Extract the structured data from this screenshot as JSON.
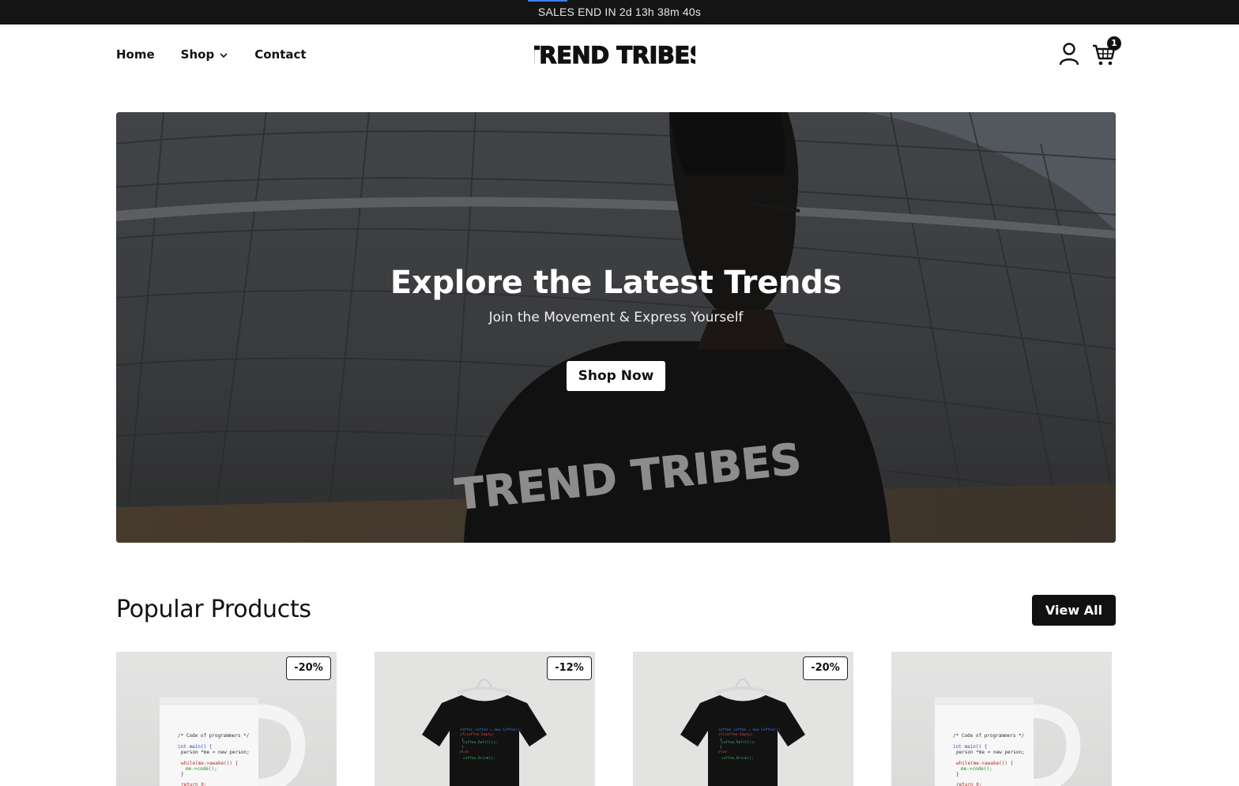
{
  "announcement": {
    "text": "SALES END IN 2d 13h 38m 40s"
  },
  "header": {
    "nav": [
      {
        "label": "Home"
      },
      {
        "label": "Shop"
      },
      {
        "label": "Contact"
      }
    ],
    "logo_text": "TREND TRIBES",
    "cart_count": "1"
  },
  "hero": {
    "title": "Explore the Latest Trends",
    "subtitle": "Join the Movement & Express Yourself",
    "cta_label": "Shop Now",
    "shirt_print": "TREND TRIBES"
  },
  "section": {
    "title": "Popular Products",
    "view_all_label": "View All"
  },
  "products": [
    {
      "type": "mug",
      "discount": "-20%"
    },
    {
      "type": "t-shirt",
      "discount": "-12%"
    },
    {
      "type": "t-shirt",
      "discount": "-20%"
    },
    {
      "type": "mug",
      "discount": ""
    }
  ],
  "colors": {
    "dark": "#141414",
    "accent": "#3b82f6",
    "card_bg": "#e1e1e0"
  }
}
